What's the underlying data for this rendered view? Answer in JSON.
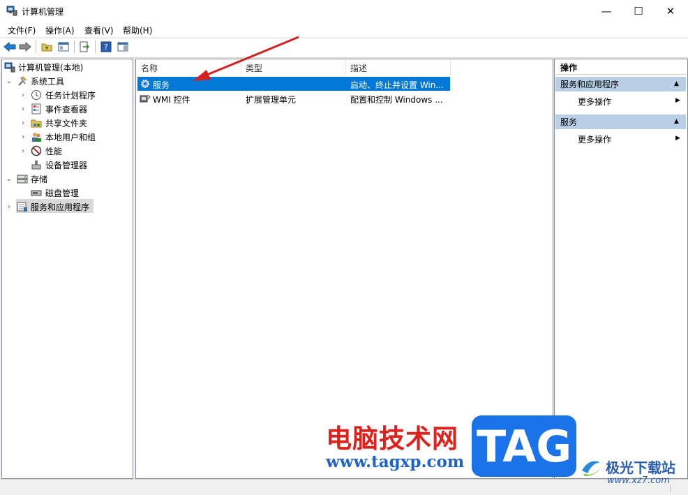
{
  "window": {
    "title": "计算机管理"
  },
  "window_controls": {
    "minimize": "—",
    "maximize": "☐",
    "close": "✕"
  },
  "menu": [
    "文件(F)",
    "操作(A)",
    "查看(V)",
    "帮助(H)"
  ],
  "tree": {
    "root": "计算机管理(本地)",
    "system_tools": "系统工具",
    "task_scheduler": "任务计划程序",
    "event_viewer": "事件查看器",
    "shared_folders": "共享文件夹",
    "local_users": "本地用户和组",
    "performance": "性能",
    "device_manager": "设备管理器",
    "storage": "存储",
    "disk_management": "磁盘管理",
    "services_apps": "服务和应用程序"
  },
  "list": {
    "headers": {
      "name": "名称",
      "type": "类型",
      "desc": "描述"
    },
    "rows": [
      {
        "name": "服务",
        "type": "",
        "desc": "启动、终止并设置 Win..."
      },
      {
        "name": "WMI 控件",
        "type": "扩展管理单元",
        "desc": "配置和控制 Windows ..."
      }
    ]
  },
  "actions": {
    "header": "操作",
    "section1": "服务和应用程序",
    "more1": "更多操作",
    "section2": "服务",
    "more2": "更多操作"
  },
  "watermark": {
    "brand_cn": "电脑技术网",
    "brand_url": "www.tagxp.com",
    "tag_logo": "TAG",
    "site2_cn": "极光下载站",
    "site2_url": "www.xz7.com"
  },
  "colors": {
    "selection": "#0078d7",
    "arrow": "#d42020",
    "watermark_red": "#e0201b",
    "watermark_blue": "#1e64c8",
    "tag_blue": "#1a73e8",
    "section_bg": "#b8cfe6"
  }
}
